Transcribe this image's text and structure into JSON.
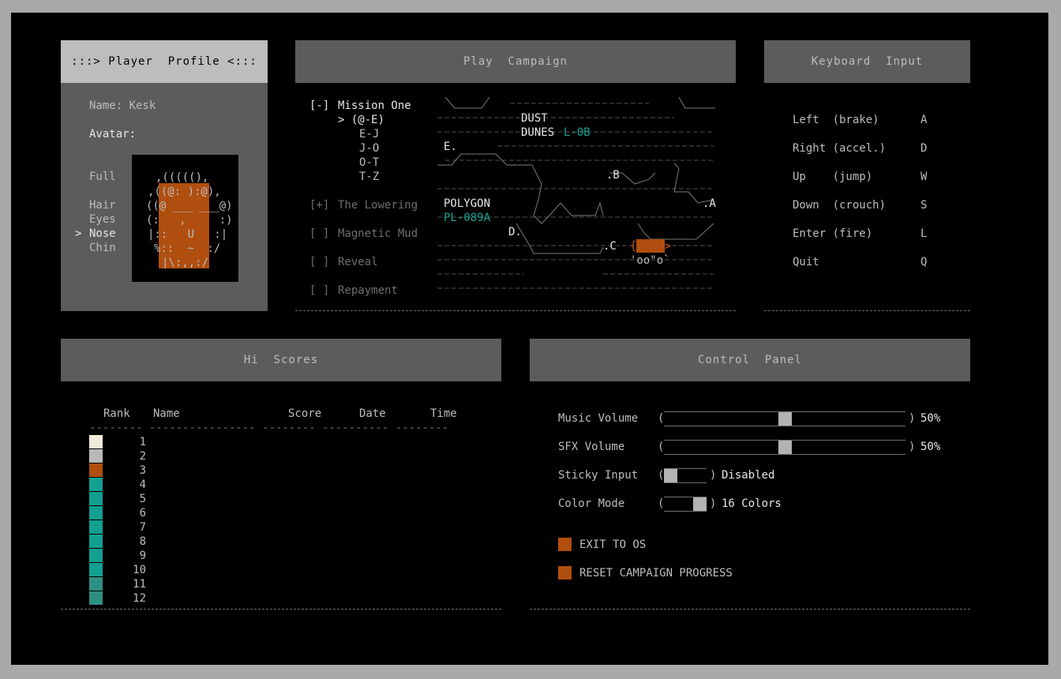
{
  "profile": {
    "title": ":::> Player  Profile <:::",
    "name_label": "Name: Kesk",
    "avatar_label": "Avatar:",
    "parts": [
      "Full",
      "Hair",
      "Eyes",
      "Nose",
      "Chin"
    ],
    "selected_part": "Nose",
    "selector_marker": ">",
    "avatar_lines": [
      ",(((((),",
      ",((@: ):@),",
      "((@ ___ ___@)",
      "(:   ,     :)",
      "|::   U   :|",
      "%::  ~  :/",
      "|\\:,,:/"
    ]
  },
  "campaign": {
    "title": "Play  Campaign",
    "missions": [
      {
        "marker": "[-]",
        "label": "Mission One"
      },
      {
        "marker": "[+]",
        "label": "The Lowering"
      },
      {
        "marker": "[ ]",
        "label": "Magnetic Mud"
      },
      {
        "marker": "[ ]",
        "label": "Reveal"
      },
      {
        "marker": "[ ]",
        "label": "Repayment"
      }
    ],
    "levels": [
      "> (@-E)",
      "E-J",
      "J-O",
      "O-T",
      "T-Z"
    ],
    "map_labels": {
      "dust": "DUST",
      "dunes": "DUNES",
      "dunes_code": "L-0B",
      "polygon": "POLYGON",
      "polygon_code": "PL-089A",
      "node_e": "E.",
      "node_b": ".B",
      "node_a": ".A",
      "node_d": "D.",
      "node_c": ".C",
      "creature": "'oo\"o`"
    }
  },
  "keyboard": {
    "title": "Keyboard  Input",
    "bindings": [
      {
        "action": "Left  (brake)",
        "key": "A"
      },
      {
        "action": "Right (accel.)",
        "key": "D"
      },
      {
        "action": "Up    (jump)",
        "key": "W"
      },
      {
        "action": "Down  (crouch)",
        "key": "S"
      },
      {
        "action": "Enter (fire)",
        "key": "L"
      },
      {
        "action": "Quit",
        "key": "Q"
      }
    ]
  },
  "scores": {
    "title": "Hi  Scores",
    "columns": [
      "Rank",
      "Name",
      "Score",
      "Date",
      "Time"
    ],
    "underline": "-------- ---------------- -------- ---------- --------",
    "ranks": [
      "1",
      "2",
      "3",
      "4",
      "5",
      "6",
      "7",
      "8",
      "9",
      "10",
      "11",
      "12"
    ],
    "rank_colors": [
      "#f0ecd8",
      "#b9b9b9",
      "#b04e0f",
      "#13a090",
      "#13a090",
      "#13a090",
      "#13a090",
      "#13a090",
      "#13a090",
      "#13a090",
      "#2f8e82",
      "#2f8e82"
    ]
  },
  "control": {
    "title": "Control  Panel",
    "music": {
      "label": "Music Volume",
      "value": "50%",
      "level": 0.5
    },
    "sfx": {
      "label": "SFX Volume",
      "value": "50%",
      "level": 0.5
    },
    "sticky": {
      "label": "Sticky Input",
      "value": "Disabled",
      "level": 0
    },
    "color_mode": {
      "label": "Color Mode",
      "value": "16 Colors",
      "level": 1
    },
    "exit_label": "EXIT TO OS",
    "reset_label": "RESET CAMPAIGN PROGRESS"
  },
  "colors": {
    "accent_orange": "#b04e0f",
    "teal": "#13a090",
    "header_bg": "#5c5c5c"
  }
}
